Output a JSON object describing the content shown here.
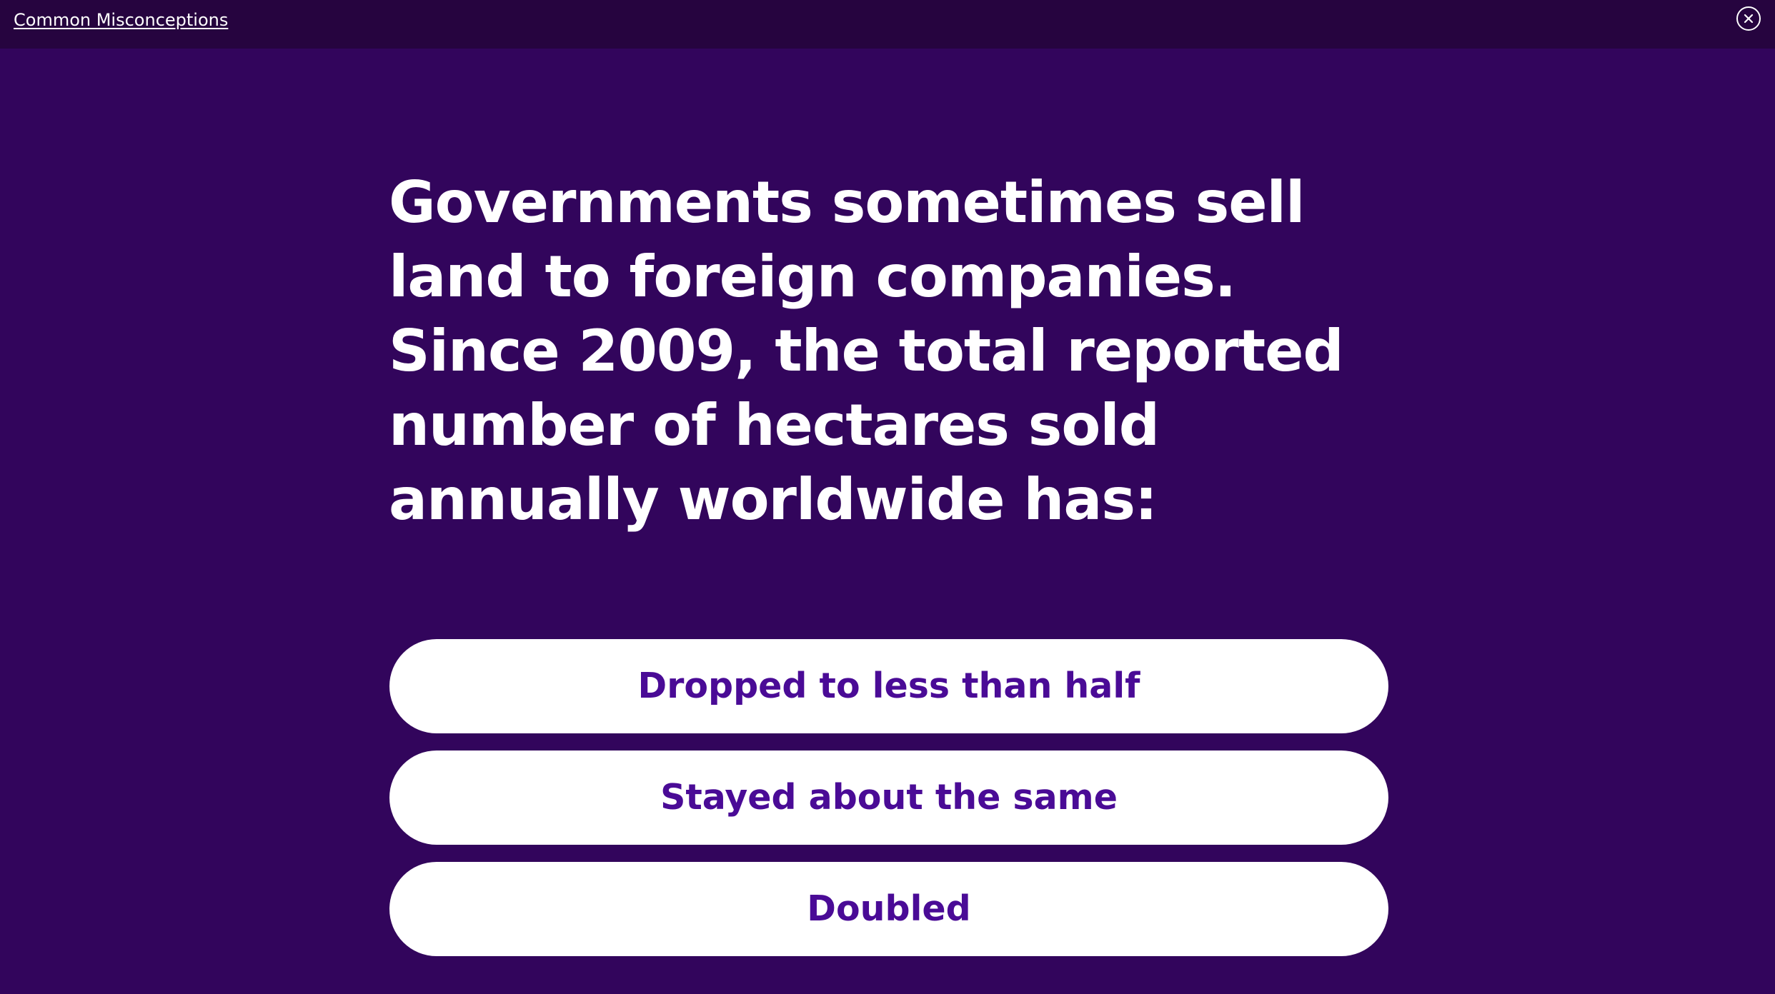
{
  "header": {
    "link_label": "Common Misconceptions",
    "close_icon": "close-icon"
  },
  "question": {
    "text": "Governments sometimes sell land to foreign companies. Since 2009, the total reported number of hectares sold annually worldwide has:"
  },
  "answers": [
    {
      "label": "Dropped to less than half"
    },
    {
      "label": "Stayed about the same"
    },
    {
      "label": "Doubled"
    }
  ],
  "colors": {
    "background": "#32055c",
    "topbar": "#26043f",
    "answer_text": "#4a0b96",
    "answer_background": "#ffffff"
  }
}
